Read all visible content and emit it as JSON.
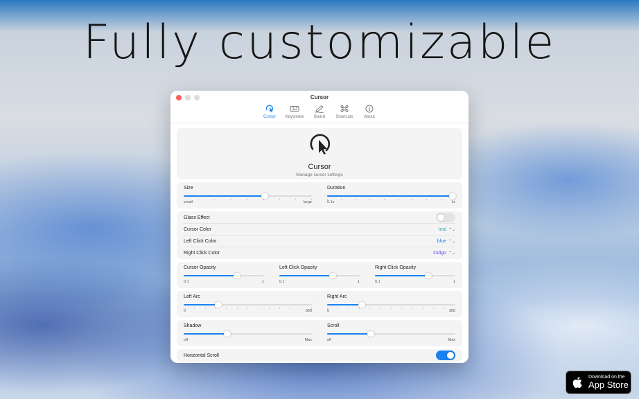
{
  "headline": "Fully customizable",
  "window": {
    "title": "Cursor",
    "tabs": [
      {
        "label": "Cursor",
        "icon": "cursor-click-icon",
        "active": true
      },
      {
        "label": "Keystroke",
        "icon": "keyboard-icon",
        "active": false
      },
      {
        "label": "Board",
        "icon": "pencil-icon",
        "active": false
      },
      {
        "label": "Shortcuts",
        "icon": "command-icon",
        "active": false
      },
      {
        "label": "About",
        "icon": "info-icon",
        "active": false
      }
    ]
  },
  "hero": {
    "title": "Cursor",
    "subtitle": "Manage cursor settings",
    "icon": "cursor-click-icon"
  },
  "sliders": {
    "size": {
      "label": "Size",
      "min_label": "small",
      "max_label": "large",
      "value": 0.63
    },
    "duration": {
      "label": "Duration",
      "min_label": "0.1s",
      "max_label": "1s",
      "value": 0.98
    },
    "cursor_opacity": {
      "label": "Cursor Opacity",
      "min_label": "0.1",
      "max_label": "1",
      "value": 0.66
    },
    "left_click_opacity": {
      "label": "Left Click Opacity",
      "min_label": "0.1",
      "max_label": "1",
      "value": 0.66
    },
    "right_click_opacity": {
      "label": "Right Click Opacity",
      "min_label": "0.1",
      "max_label": "1",
      "value": 0.66
    },
    "left_arc": {
      "label": "Left Arc",
      "min_label": "0",
      "max_label": "360",
      "value": 0.27
    },
    "right_arc": {
      "label": "Right Arc",
      "min_label": "0",
      "max_label": "360",
      "value": 0.27
    },
    "shadow": {
      "label": "Shadow",
      "min_label": "off",
      "max_label": "Max",
      "value": 0.34
    },
    "scroll": {
      "label": "Scroll",
      "min_label": "off",
      "max_label": "Max",
      "value": 0.34
    }
  },
  "options": {
    "glass_effect": {
      "label": "Glass Effect",
      "on": false
    },
    "cursor_color": {
      "label": "Cursor Color",
      "value": "teal",
      "color": "#38a5b5"
    },
    "left_click_color": {
      "label": "Left Click Color",
      "value": "blue",
      "color": "#1a82f0"
    },
    "right_click_color": {
      "label": "Right Click Color",
      "value": "indigo",
      "color": "#5b4fd6"
    },
    "horizontal_scroll": {
      "label": "Horizontal Scroll",
      "on": true
    }
  },
  "app_store": {
    "line1": "Download on the",
    "line2": "App Store"
  },
  "colors": {
    "accent": "#1a82f0",
    "close": "#fe5f57"
  }
}
